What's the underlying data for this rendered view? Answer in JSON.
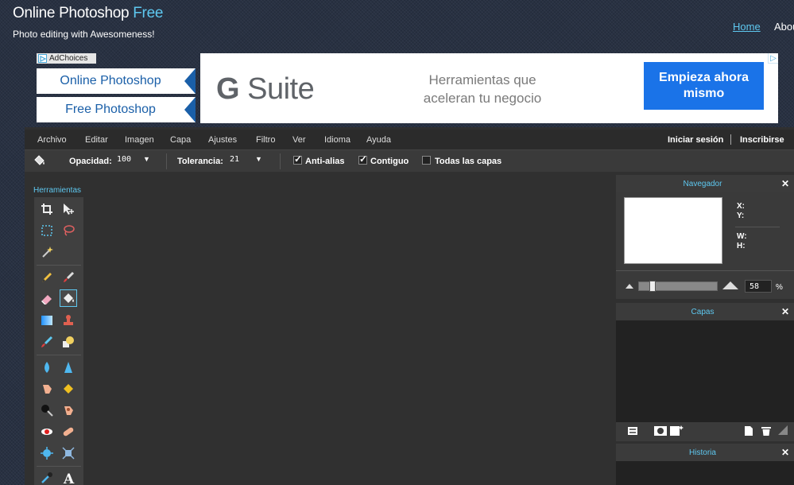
{
  "header": {
    "title_main": "Online Photoshop",
    "title_accent": "Free",
    "subtitle": "Photo editing with Awesomeness!",
    "nav": {
      "home": "Home",
      "about": "Abou"
    },
    "accent_color": "#5ec8f0"
  },
  "ads": {
    "adchoices": "AdChoices",
    "link1": "Online Photoshop",
    "link2": "Free Photoshop",
    "banner": {
      "brand_bold": "G",
      "brand_rest": " Suite",
      "tagline": "Herramientas que aceleran tu negocio",
      "cta": "Empieza ahora mismo",
      "cta_color": "#1a73e8"
    }
  },
  "menubar": {
    "items": [
      "Archivo",
      "Editar",
      "Imagen",
      "Capa",
      "Ajustes",
      "Filtro",
      "Ver",
      "Idioma",
      "Ayuda"
    ],
    "login": "Iniciar sesión",
    "signup": "Inscribirse"
  },
  "options": {
    "tool_icon": "paint-bucket-icon",
    "opacity_label": "Opacidad:",
    "opacity_value": "100",
    "tolerance_label": "Tolerancia:",
    "tolerance_value": "21",
    "antialias_label": "Anti-alias",
    "antialias_checked": true,
    "contiguous_label": "Contiguo",
    "contiguous_checked": true,
    "all_layers_label": "Todas las capas",
    "all_layers_checked": false
  },
  "tools": {
    "title": "Herramientas",
    "selected": "paint-bucket-tool",
    "icons": [
      "crop-icon",
      "move-icon",
      "marquee-icon",
      "lasso-icon",
      "magic-wand-icon",
      "pencil-icon",
      "brush-icon",
      "eraser-icon",
      "paint-bucket-icon",
      "gradient-icon",
      "clone-stamp-icon",
      "color-replace-icon",
      "drawing-icon",
      "blur-icon",
      "sharpen-icon",
      "smudge-icon",
      "sponge-icon",
      "dodge-icon",
      "burn-icon",
      "red-eye-icon",
      "spot-heal-icon",
      "bloat-icon",
      "pinch-icon",
      "color-picker-icon",
      "type-icon"
    ]
  },
  "navigator": {
    "title": "Navegador",
    "x_label": "X:",
    "y_label": "Y:",
    "w_label": "W:",
    "h_label": "H:",
    "zoom_value": "58",
    "zoom_unit": "%"
  },
  "layers": {
    "title": "Capas"
  },
  "history": {
    "title": "Historia"
  }
}
